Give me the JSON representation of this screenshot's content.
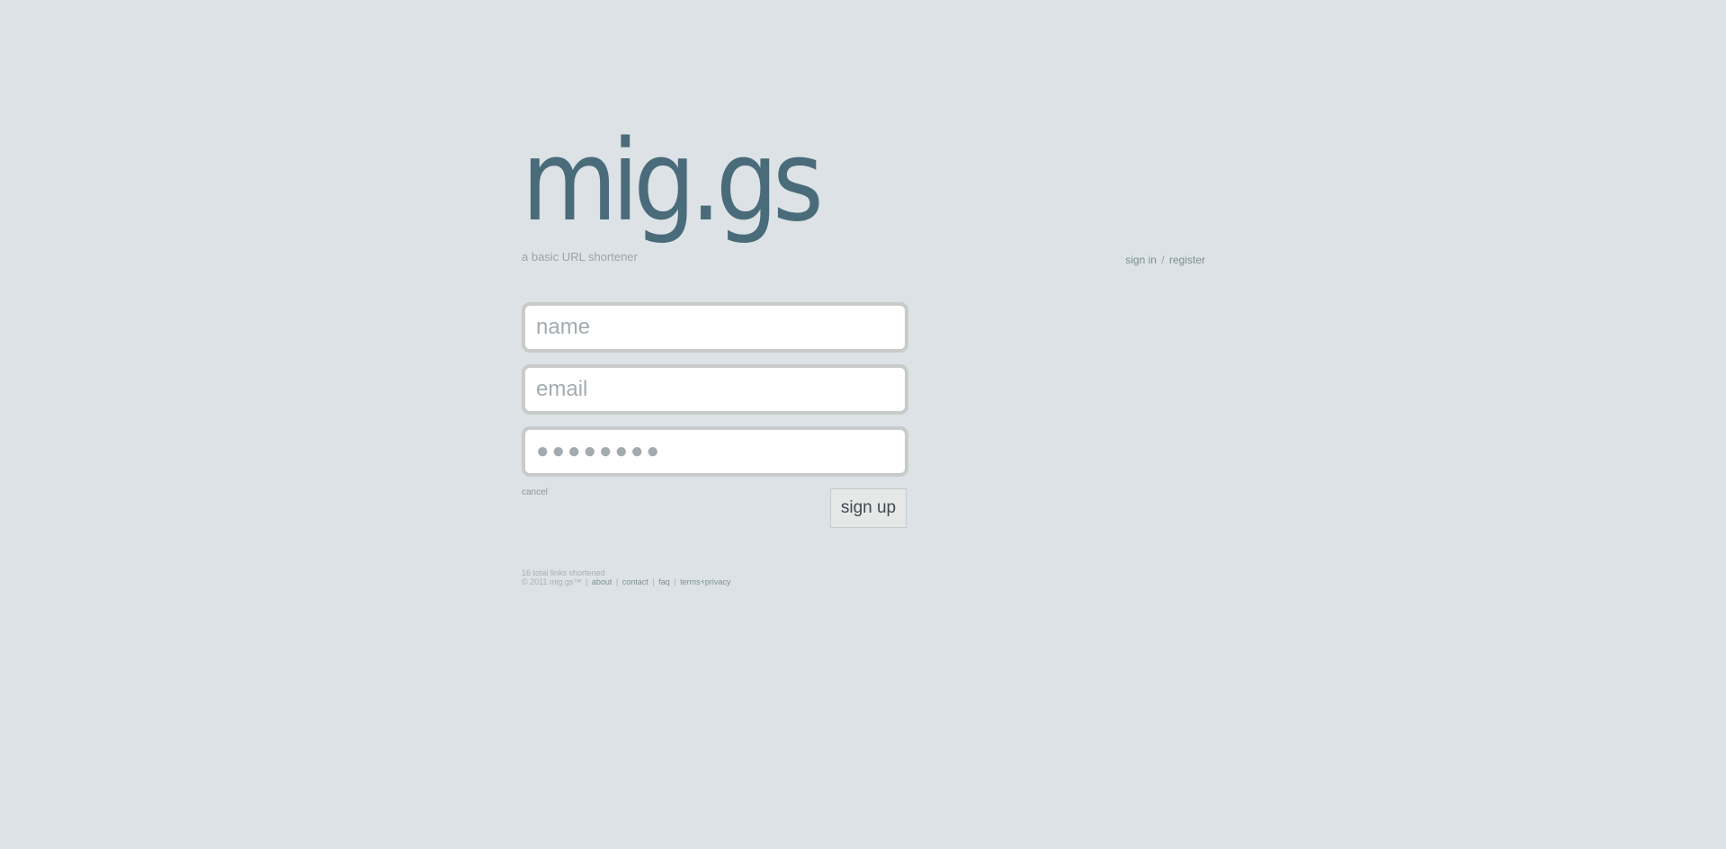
{
  "brand": {
    "logo": "mig.gs",
    "tagline": "a basic URL shortener",
    "color": "#4a6b7a"
  },
  "auth": {
    "sign_in": "sign in",
    "separator": "/",
    "register": "register"
  },
  "form": {
    "name_placeholder": "name",
    "email_placeholder": "email",
    "password_placeholder": "●●●●●●●●",
    "cancel": "cancel",
    "submit": "sign up"
  },
  "footer": {
    "stats": "16 total links shortened",
    "copyright": "© 2011 mig.gs™",
    "links": [
      "about",
      "contact",
      "faq",
      "terms+privacy"
    ]
  }
}
